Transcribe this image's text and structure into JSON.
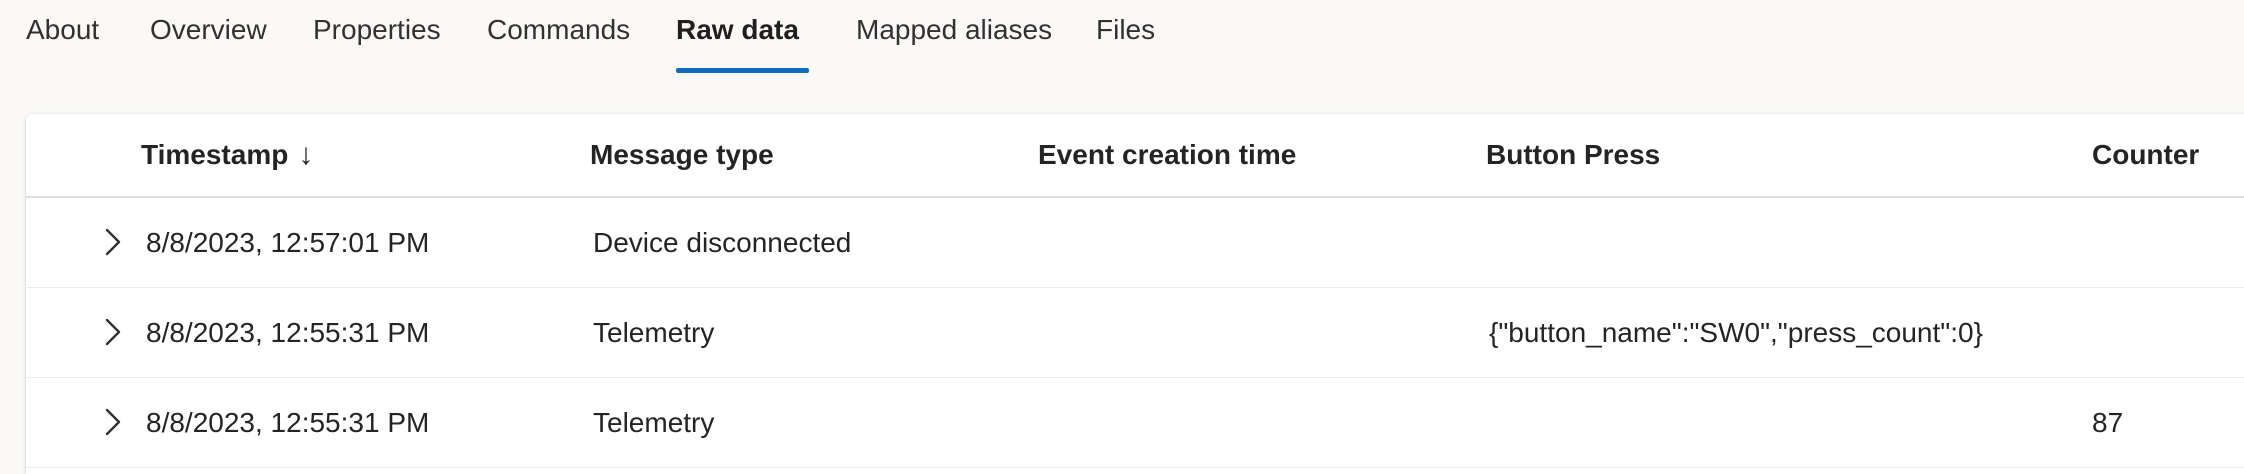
{
  "tabs": [
    {
      "label": "About"
    },
    {
      "label": "Overview"
    },
    {
      "label": "Properties"
    },
    {
      "label": "Commands"
    },
    {
      "label": "Raw data"
    },
    {
      "label": "Mapped aliases"
    },
    {
      "label": "Files"
    }
  ],
  "active_tab": "Raw data",
  "accent_color": "#0f6cbd",
  "table": {
    "columns": [
      {
        "label": "Timestamp",
        "sort_icon": "↓"
      },
      {
        "label": "Message type"
      },
      {
        "label": "Event creation time"
      },
      {
        "label": "Button Press"
      },
      {
        "label": "Counter"
      }
    ],
    "rows": [
      {
        "timestamp": "8/8/2023, 12:57:01 PM",
        "message_type": "Device disconnected",
        "event_creation_time": "",
        "button_press": "",
        "counter": ""
      },
      {
        "timestamp": "8/8/2023, 12:55:31 PM",
        "message_type": "Telemetry",
        "event_creation_time": "",
        "button_press": "{\"button_name\":\"SW0\",\"press_count\":0}",
        "counter": ""
      },
      {
        "timestamp": "8/8/2023, 12:55:31 PM",
        "message_type": "Telemetry",
        "event_creation_time": "",
        "button_press": "",
        "counter": "87"
      }
    ]
  }
}
